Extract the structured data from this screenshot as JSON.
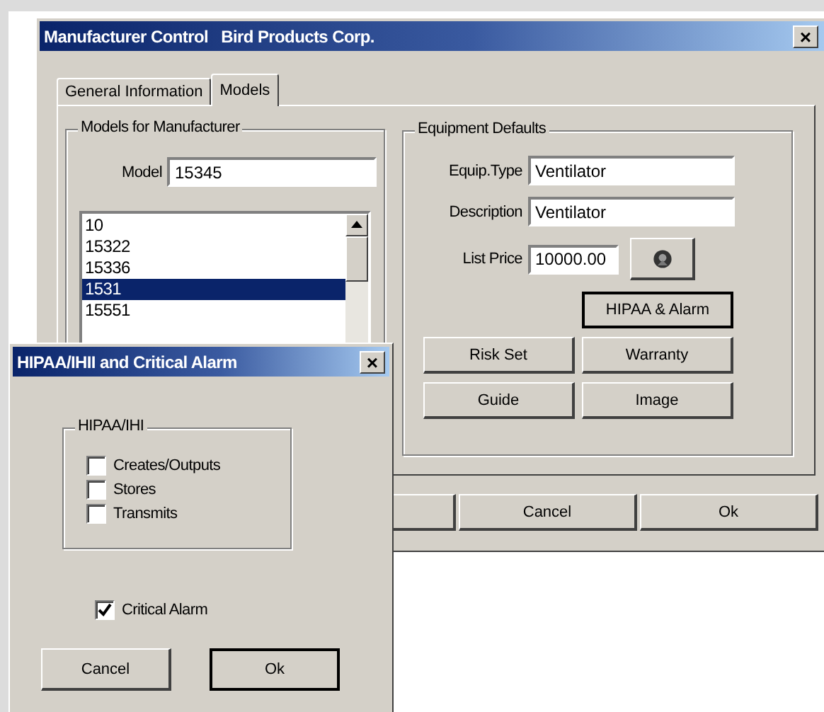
{
  "main_window": {
    "title": "Manufacturer Control   Bird Products Corp.",
    "close": "×"
  },
  "tabs": [
    {
      "label": "General Information",
      "selected": false
    },
    {
      "label": "Models",
      "selected": true
    }
  ],
  "models_group": {
    "title": "Models for Manufacturer",
    "model_label": "Model",
    "model_value": "15345",
    "list": [
      {
        "text": "10",
        "selected": false
      },
      {
        "text": "15322",
        "selected": false
      },
      {
        "text": "15336",
        "selected": false
      },
      {
        "text": "1531",
        "selected": true
      },
      {
        "text": "15551",
        "selected": false
      }
    ]
  },
  "equipment_group": {
    "title": "Equipment Defaults",
    "fields": [
      {
        "label": "Equip.Type",
        "value": "Ventilator"
      },
      {
        "label": "Description",
        "value": "Ventilator"
      },
      {
        "label": "List Price",
        "value": "10000.00"
      }
    ],
    "buttons": [
      {
        "label": "HIPAA & Alarm",
        "default": true
      },
      {
        "label": "Risk Set",
        "default": false
      },
      {
        "label": "Warranty",
        "default": false
      },
      {
        "label": "Guide",
        "default": false
      },
      {
        "label": "Image",
        "default": false
      }
    ]
  },
  "bottom_buttons": [
    "Cancel",
    "Ok"
  ],
  "dialog": {
    "title": "HIPAA/IHII and Critical Alarm",
    "close": "×",
    "group": {
      "title": "HIPAA/IHI",
      "options": [
        {
          "label": "Creates/Outputs",
          "checked": false
        },
        {
          "label": "Stores",
          "checked": false
        },
        {
          "label": "Transmits",
          "checked": false
        }
      ]
    },
    "critical": {
      "label": "Critical Alarm",
      "checked": true
    },
    "buttons": [
      {
        "label": "Cancel",
        "default": false
      },
      {
        "label": "Ok",
        "default": true
      }
    ]
  }
}
